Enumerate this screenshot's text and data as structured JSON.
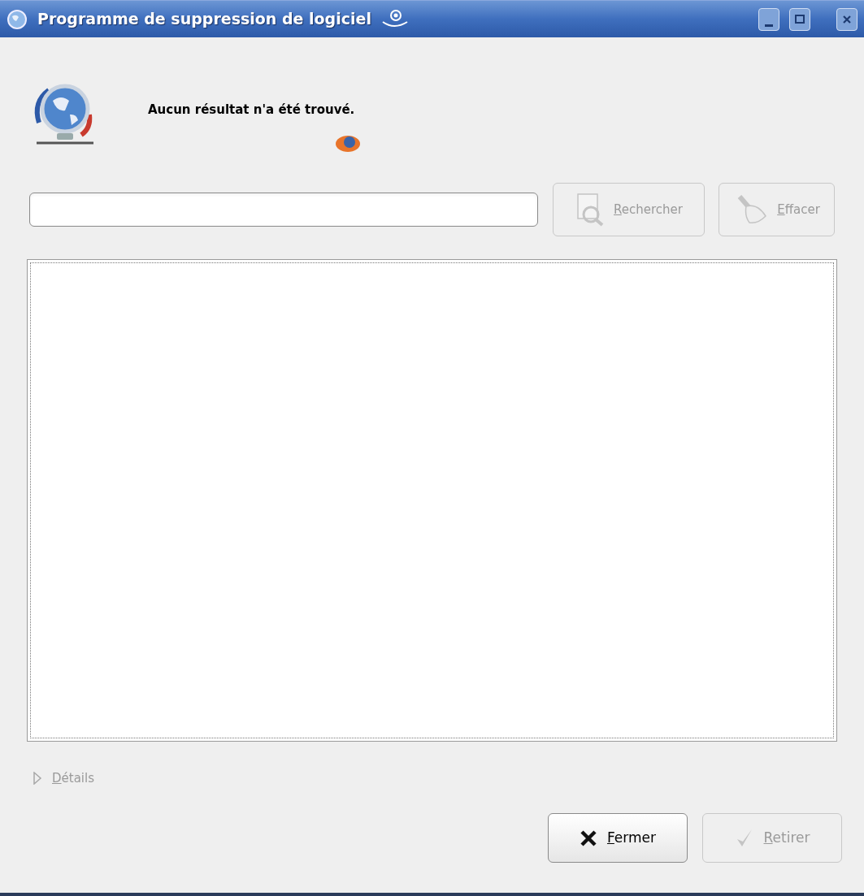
{
  "window": {
    "title": "Programme de suppression de logiciel"
  },
  "message": "Aucun résultat n'a été trouvé.",
  "search_buttons": [
    {
      "label": "Rechercher",
      "kind": "search",
      "disabled": true
    },
    {
      "label": "Effacer",
      "kind": "clear",
      "disabled": true
    }
  ],
  "details": {
    "label": "Détails",
    "disabled": true,
    "expanded": false
  },
  "action_buttons": [
    {
      "label": "Fermer",
      "kind": "close",
      "disabled": false
    },
    {
      "label": "Retirer",
      "kind": "remove",
      "disabled": true
    }
  ]
}
